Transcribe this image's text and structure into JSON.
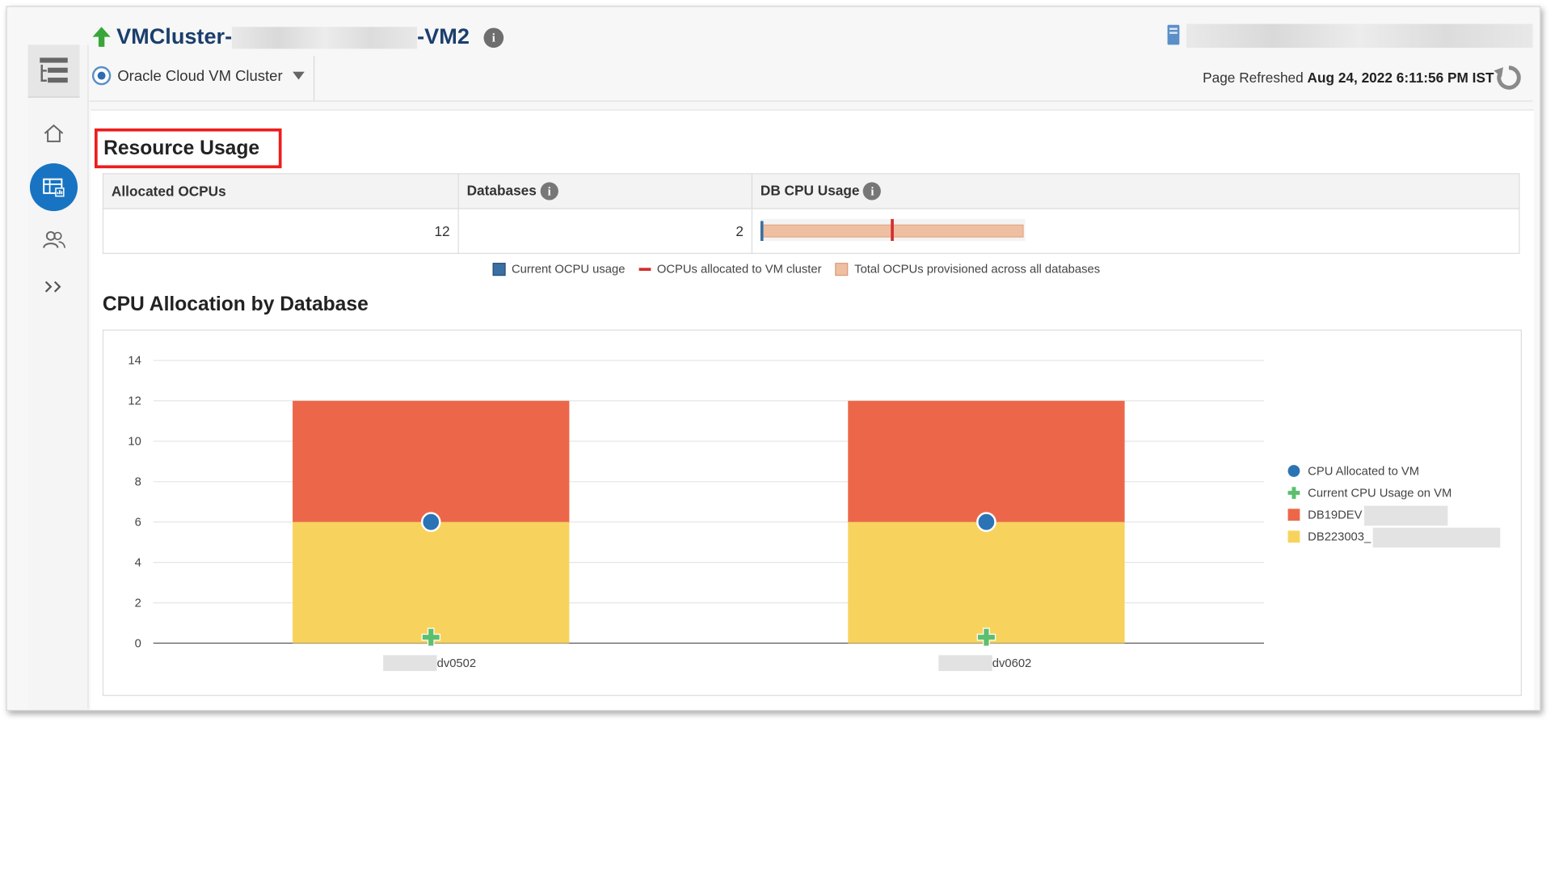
{
  "header": {
    "title_prefix": "VMCluster-",
    "title_suffix": "-VM2",
    "target_type": "Oracle Cloud VM Cluster",
    "page_refreshed_label": "Page Refreshed",
    "page_refreshed_value": "Aug 24, 2022 6:11:56 PM IST"
  },
  "sidebar": {
    "items": [
      {
        "name": "home",
        "icon": "home-icon"
      },
      {
        "name": "dashboard",
        "icon": "dashboard-icon"
      },
      {
        "name": "users",
        "icon": "users-icon"
      },
      {
        "name": "expand",
        "icon": "chevron-right-double-icon"
      }
    ]
  },
  "resource_usage": {
    "heading": "Resource Usage",
    "columns": [
      "Allocated OCPUs",
      "Databases",
      "DB CPU Usage"
    ],
    "allocated_ocpus": "12",
    "databases": "2",
    "db_cpu_usage": {
      "current_ocpu": 0,
      "allocated_to_vm_cluster": 12,
      "total_provisioned": 24
    },
    "legend": [
      {
        "label": "Current OCPU usage",
        "color": "#3a6fa3"
      },
      {
        "label": "OCPUs allocated to VM cluster",
        "color": "#d32f2f"
      },
      {
        "label": "Total OCPUs provisioned across all databases",
        "color": "#efbfa2"
      }
    ]
  },
  "cpu_allocation": {
    "heading": "CPU Allocation by Database"
  },
  "colors": {
    "accent": "#1874c2",
    "title": "#1b3e6d",
    "db19": "#ec6749",
    "db223": "#f7d35e",
    "cpu_alloc": "#2a74b5",
    "cpu_usage": "#5cbf6f"
  },
  "chart_data": {
    "type": "bar",
    "stacked": true,
    "categories": [
      "dv0502",
      "dv0602"
    ],
    "series": [
      {
        "name": "DB223003_",
        "values": [
          6,
          6
        ]
      },
      {
        "name": "DB19DEV",
        "values": [
          6,
          6
        ]
      }
    ],
    "markers": [
      {
        "name": "CPU Allocated to VM",
        "values": [
          6,
          6
        ],
        "shape": "circle"
      },
      {
        "name": "Current CPU Usage on VM",
        "values": [
          0,
          0
        ],
        "shape": "plus"
      }
    ],
    "yticks": [
      "0",
      "2",
      "4",
      "6",
      "8",
      "10",
      "12",
      "14"
    ],
    "ylim": [
      0,
      14
    ],
    "grid": true,
    "legend_position": "right"
  }
}
